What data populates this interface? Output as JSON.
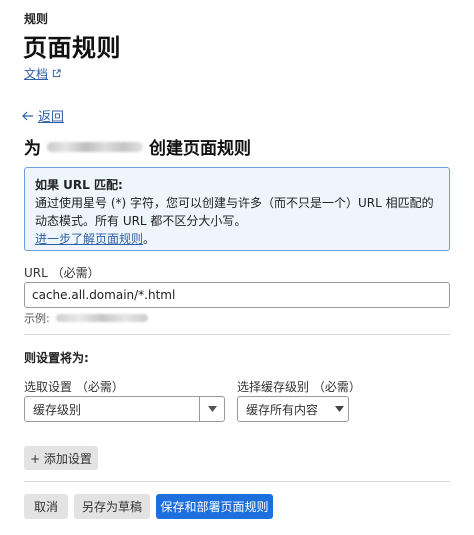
{
  "header": {
    "eyebrow": "规则",
    "title": "页面规则",
    "docs_label": "文档"
  },
  "back": {
    "label": "返回"
  },
  "heading": {
    "prefix": "为",
    "suffix": "创建页面规则"
  },
  "info": {
    "title": "如果 URL 匹配:",
    "line1": "通过使用星号 (*) 字符，您可以创建与许多（而不只是一个）URL 相匹配的动态模式。所有 URL 都不区分大小写。",
    "link": "进一步了解页面规则",
    "link_suffix": "。"
  },
  "url_field": {
    "label": "URL （必需）",
    "value": "cache.all.domain/*.html",
    "example_label": "示例:"
  },
  "settings": {
    "section_title": "则设置将为:",
    "pick_label": "选取设置 （必需）",
    "pick_value": "缓存级别",
    "level_label": "选择缓存级别 （必需）",
    "level_value": "缓存所有内容",
    "add_button": "+ 添加设置"
  },
  "actions": {
    "cancel": "取消",
    "save_draft": "另存为草稿",
    "save_deploy": "保存和部署页面规则"
  },
  "colors": {
    "link": "#2f5fa6",
    "info_bg": "#eef5fc",
    "info_border": "#6fa0d8",
    "primary": "#1e6fde"
  }
}
